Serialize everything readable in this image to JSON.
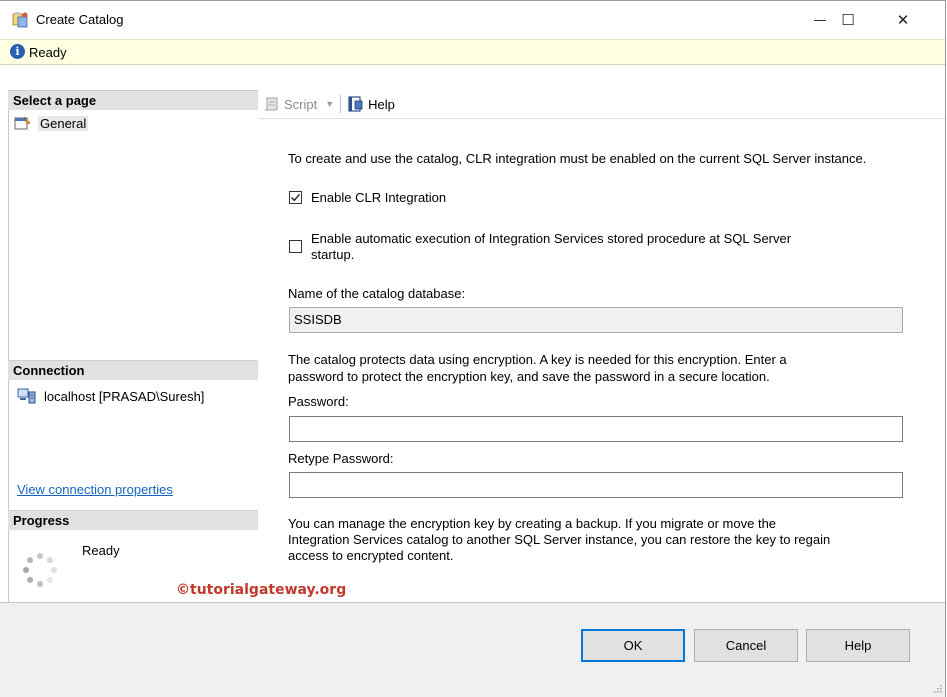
{
  "window": {
    "title": "Create Catalog",
    "minimize_glyph": "—",
    "maximize_glyph": "☐",
    "close_glyph": "✕"
  },
  "status": {
    "text": "Ready",
    "icon": "info-icon"
  },
  "sidebar": {
    "select_page_header": "Select a page",
    "pages": [
      {
        "label": "General",
        "icon": "page-settings-icon"
      }
    ],
    "connection_header": "Connection",
    "connection_item": "localhost [PRASAD\\Suresh]",
    "view_connection_link": "View connection properties",
    "progress_header": "Progress",
    "progress_status": "Ready"
  },
  "toolbar": {
    "script_label": "Script",
    "help_label": "Help"
  },
  "form": {
    "clr_intro": "To create and use the catalog, CLR integration must be enabled on the current SQL Server instance.",
    "enable_clr_label": "Enable CLR Integration",
    "enable_clr_checked": true,
    "auto_exec_label_line1": "Enable automatic execution of Integration Services stored procedure at SQL Server",
    "auto_exec_label_line2": "startup.",
    "auto_exec_checked": false,
    "catalog_db_label": "Name of the catalog database:",
    "catalog_db_value": "SSISDB",
    "encryption_text_line1": "The catalog protects data using encryption. A key is needed for this encryption. Enter a",
    "encryption_text_line2": "password to protect the encryption key, and save the password in a secure location.",
    "password_label": "Password:",
    "password_value": "",
    "retype_label": "Retype Password:",
    "retype_value": "",
    "backup_text_line1": "You can manage the encryption key by creating a backup. If you migrate or move the",
    "backup_text_line2": "Integration Services catalog to another SQL Server instance, you can restore the key to regain",
    "backup_text_line3": "access to encrypted content."
  },
  "watermark": "©tutorialgateway.org",
  "buttons": {
    "ok": "OK",
    "cancel": "Cancel",
    "help": "Help"
  },
  "colors": {
    "link": "#1565c0",
    "status_bg": "#ffffe1",
    "accent": "#0078d7",
    "watermark": "#c0392b"
  }
}
